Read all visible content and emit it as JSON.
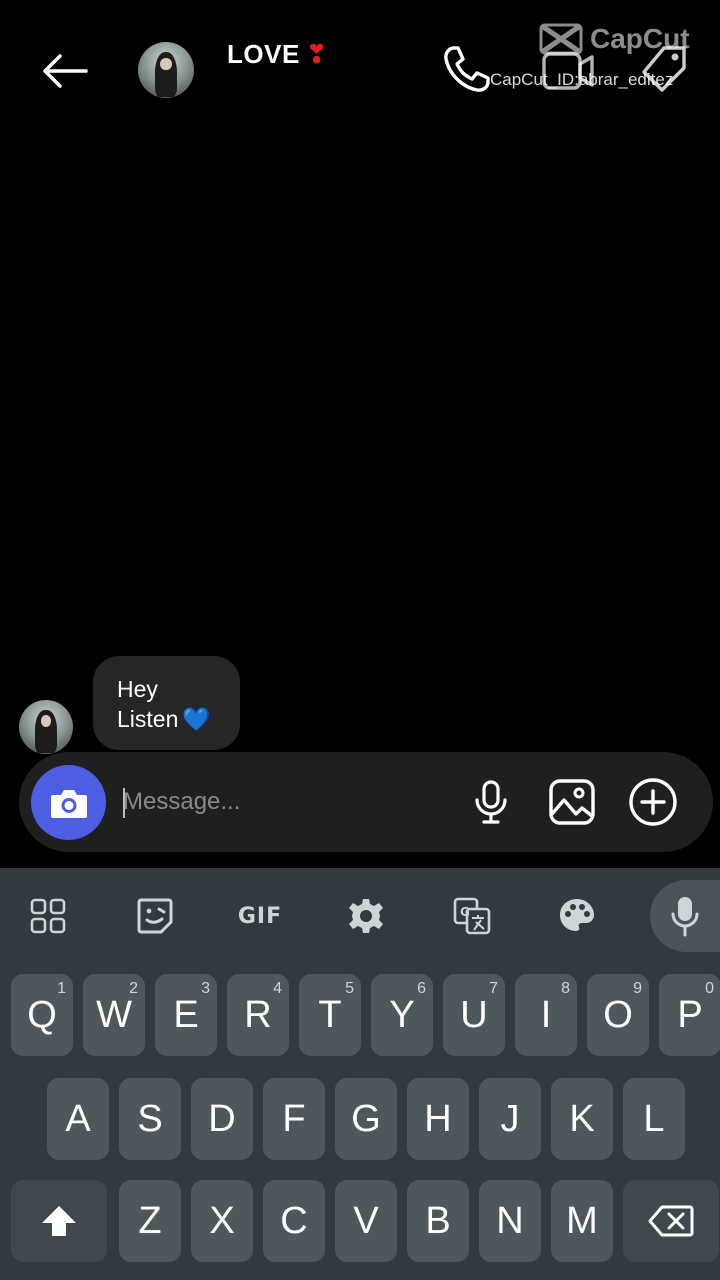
{
  "header": {
    "title": "LOVE",
    "title_emoji": "❣",
    "back_icon": "arrow-left-icon",
    "call_icon": "phone-icon",
    "video_icon": "video-camera-icon",
    "tag_icon": "tag-icon"
  },
  "watermark": {
    "logo_text": "CapCut",
    "id_text": "CapCut_ID:abrar_editez"
  },
  "messages": [
    {
      "line1": "Hey",
      "line2": "Listen",
      "emoji": "💙"
    }
  ],
  "composer": {
    "placeholder": "Message...",
    "camera_icon": "camera-icon",
    "mic_icon": "microphone-icon",
    "gallery_icon": "image-icon",
    "plus_icon": "plus-circle-icon"
  },
  "keyboard": {
    "toolbar": {
      "gif_label": "GIF"
    },
    "row1": [
      {
        "k": "Q",
        "n": "1"
      },
      {
        "k": "W",
        "n": "2"
      },
      {
        "k": "E",
        "n": "3"
      },
      {
        "k": "R",
        "n": "4"
      },
      {
        "k": "T",
        "n": "5"
      },
      {
        "k": "Y",
        "n": "6"
      },
      {
        "k": "U",
        "n": "7"
      },
      {
        "k": "I",
        "n": "8"
      },
      {
        "k": "O",
        "n": "9"
      },
      {
        "k": "P",
        "n": "0"
      }
    ],
    "row2": [
      "A",
      "S",
      "D",
      "F",
      "G",
      "H",
      "J",
      "K",
      "L"
    ],
    "row3": [
      "Z",
      "X",
      "C",
      "V",
      "B",
      "N",
      "M"
    ]
  },
  "colors": {
    "background": "#000000",
    "bubble": "#262626",
    "composer": "#1f1f1f",
    "camera_button": "#4e5ee4",
    "keyboard": "#313a3e",
    "key": "#4d575c"
  }
}
